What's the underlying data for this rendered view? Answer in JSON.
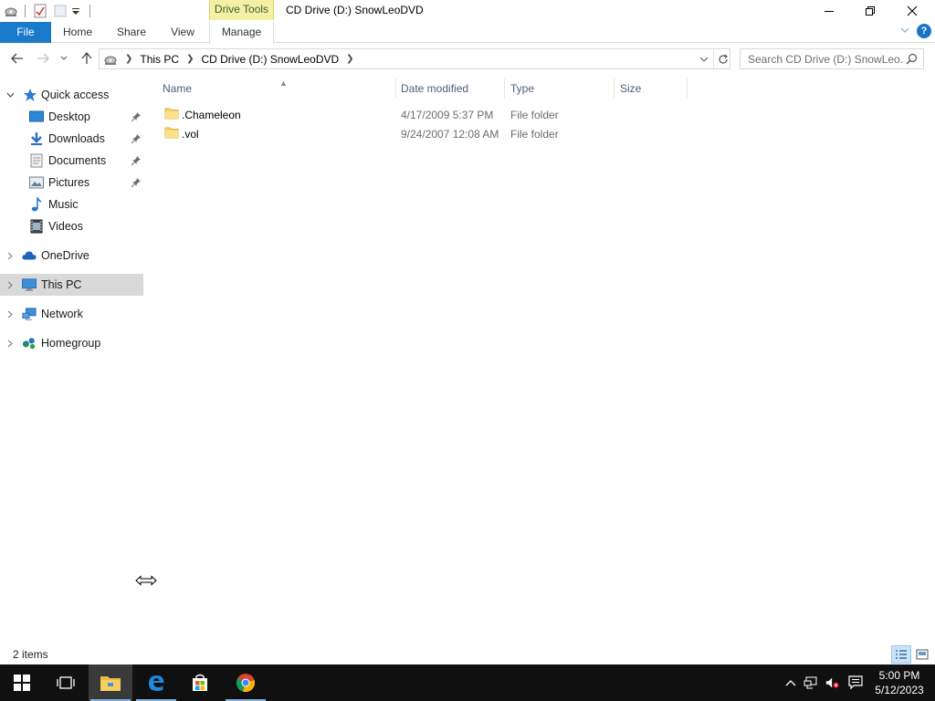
{
  "window": {
    "title": "CD Drive (D:) SnowLeoDVD",
    "contextual_tab_group": "Drive Tools"
  },
  "ribbon": {
    "tabs": [
      {
        "label": "File"
      },
      {
        "label": "Home"
      },
      {
        "label": "Share"
      },
      {
        "label": "View"
      },
      {
        "label": "Manage"
      }
    ]
  },
  "address": {
    "breadcrumbs": [
      "This PC",
      "CD Drive (D:) SnowLeoDVD"
    ]
  },
  "search": {
    "placeholder": "Search CD Drive (D:) SnowLeo..."
  },
  "navpane": {
    "quick_access": {
      "label": "Quick access",
      "items": [
        {
          "label": "Desktop",
          "icon": "desktop-icon",
          "pinned": true
        },
        {
          "label": "Downloads",
          "icon": "downloads-icon",
          "pinned": true
        },
        {
          "label": "Documents",
          "icon": "documents-icon",
          "pinned": true
        },
        {
          "label": "Pictures",
          "icon": "pictures-icon",
          "pinned": true
        },
        {
          "label": "Music",
          "icon": "music-icon",
          "pinned": false
        },
        {
          "label": "Videos",
          "icon": "videos-icon",
          "pinned": false
        }
      ]
    },
    "roots": [
      {
        "label": "OneDrive",
        "icon": "onedrive-icon",
        "selected": false
      },
      {
        "label": "This PC",
        "icon": "this-pc-icon",
        "selected": true
      },
      {
        "label": "Network",
        "icon": "network-icon",
        "selected": false
      },
      {
        "label": "Homegroup",
        "icon": "homegroup-icon",
        "selected": false
      }
    ]
  },
  "filelist": {
    "columns": [
      "Name",
      "Date modified",
      "Type",
      "Size"
    ],
    "rows": [
      {
        "name": ".Chameleon",
        "date_modified": "4/17/2009 5:37 PM",
        "type": "File folder",
        "size": ""
      },
      {
        "name": ".vol",
        "date_modified": "9/24/2007 12:08 AM",
        "type": "File folder",
        "size": ""
      }
    ]
  },
  "status": {
    "item_count": "2 items"
  },
  "taskbar": {
    "apps": [
      "start-icon",
      "task-view-icon",
      "file-explorer-icon",
      "edge-icon",
      "store-icon",
      "chrome-icon"
    ],
    "clock_time": "5:00 PM",
    "clock_date": "5/12/2023"
  },
  "colors": {
    "file_tab": "#1979ca",
    "drive_tools": "#f4f1a6",
    "selection": "#d9d9d9",
    "taskbar": "#101010"
  }
}
